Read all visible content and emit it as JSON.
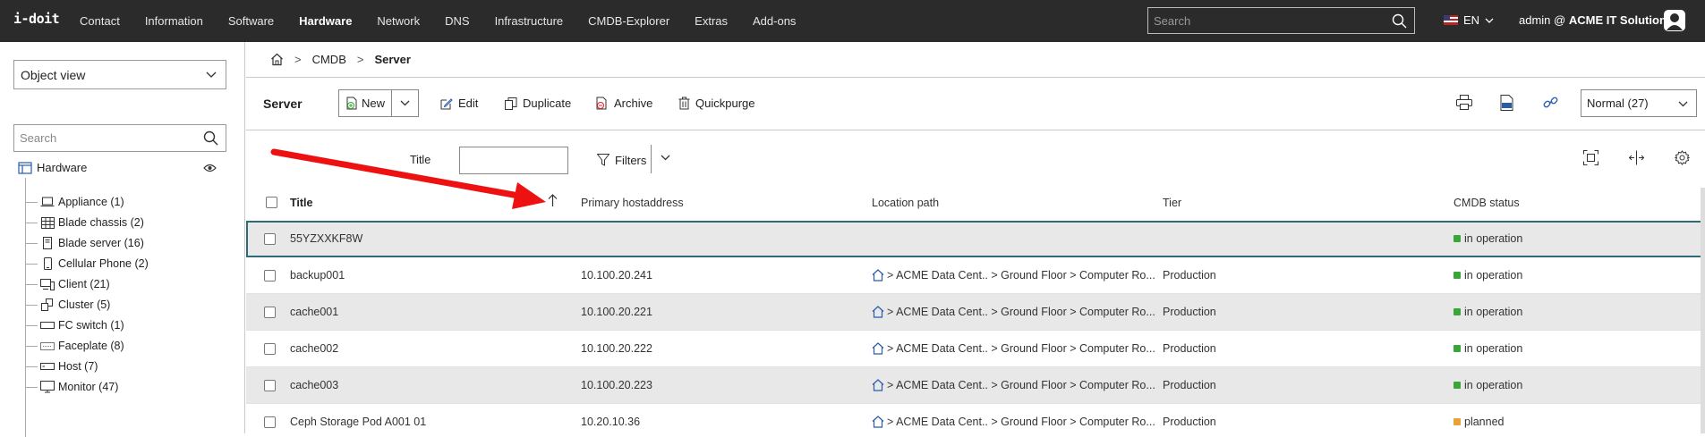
{
  "topbar": {
    "logo": "i-doit",
    "nav": [
      "Contact",
      "Information",
      "Software",
      "Hardware",
      "Network",
      "DNS",
      "Infrastructure",
      "CMDB-Explorer",
      "Extras",
      "Add-ons"
    ],
    "active_nav": "Hardware",
    "search_placeholder": "Search",
    "language": "EN",
    "user_prefix": "admin @",
    "tenant": "ACME IT Solutions"
  },
  "sidebar": {
    "view_select": "Object view",
    "search_placeholder": "Search",
    "root": "Hardware",
    "items": [
      {
        "label": "Appliance (1)",
        "icon": "laptop-icon"
      },
      {
        "label": "Blade chassis (2)",
        "icon": "chassis-icon"
      },
      {
        "label": "Blade server (16)",
        "icon": "blade-icon"
      },
      {
        "label": "Cellular Phone (2)",
        "icon": "phone-icon"
      },
      {
        "label": "Client (21)",
        "icon": "client-icon"
      },
      {
        "label": "Cluster (5)",
        "icon": "cluster-icon"
      },
      {
        "label": "FC switch (1)",
        "icon": "switch-icon"
      },
      {
        "label": "Faceplate (8)",
        "icon": "faceplate-icon"
      },
      {
        "label": "Host (7)",
        "icon": "host-icon"
      },
      {
        "label": "Monitor (47)",
        "icon": "monitor-icon"
      }
    ]
  },
  "breadcrumb": {
    "items": [
      "CMDB",
      "Server"
    ]
  },
  "toolbar": {
    "title": "Server",
    "new": "New",
    "edit": "Edit",
    "duplicate": "Duplicate",
    "archive": "Archive",
    "quickpurge": "Quickpurge",
    "view_mode": "Normal (27)"
  },
  "filter": {
    "title_label": "Title",
    "filters_label": "Filters"
  },
  "table": {
    "columns": [
      "Title",
      "Primary hostaddress",
      "Location path",
      "Tier",
      "CMDB status"
    ],
    "rows": [
      {
        "title": "55YZXXKF8W",
        "ip": "",
        "location": "",
        "tier": "",
        "status": "in operation",
        "status_color": "#3aa63a"
      },
      {
        "title": "backup001",
        "ip": "10.100.20.241",
        "location": "> ACME Data Cent.. > Ground Floor > Computer Ro...",
        "tier": "Production",
        "status": "in operation",
        "status_color": "#3aa63a"
      },
      {
        "title": "cache001",
        "ip": "10.100.20.221",
        "location": "> ACME Data Cent.. > Ground Floor > Computer Ro...",
        "tier": "Production",
        "status": "in operation",
        "status_color": "#3aa63a"
      },
      {
        "title": "cache002",
        "ip": "10.100.20.222",
        "location": "> ACME Data Cent.. > Ground Floor > Computer Ro...",
        "tier": "Production",
        "status": "in operation",
        "status_color": "#3aa63a"
      },
      {
        "title": "cache003",
        "ip": "10.100.20.223",
        "location": "> ACME Data Cent.. > Ground Floor > Computer Ro...",
        "tier": "Production",
        "status": "in operation",
        "status_color": "#3aa63a"
      },
      {
        "title": "Ceph Storage Pod A001 01",
        "ip": "10.20.10.36",
        "location": "> ACME Data Cent.. > Ground Floor > Computer Ro...",
        "tier": "Production",
        "status": "planned",
        "status_color": "#e8a23a"
      }
    ]
  },
  "colors": {
    "topbar": "#2b2b2b",
    "selected_border": "#2f6b76",
    "annotation_arrow": "#ee1111"
  }
}
